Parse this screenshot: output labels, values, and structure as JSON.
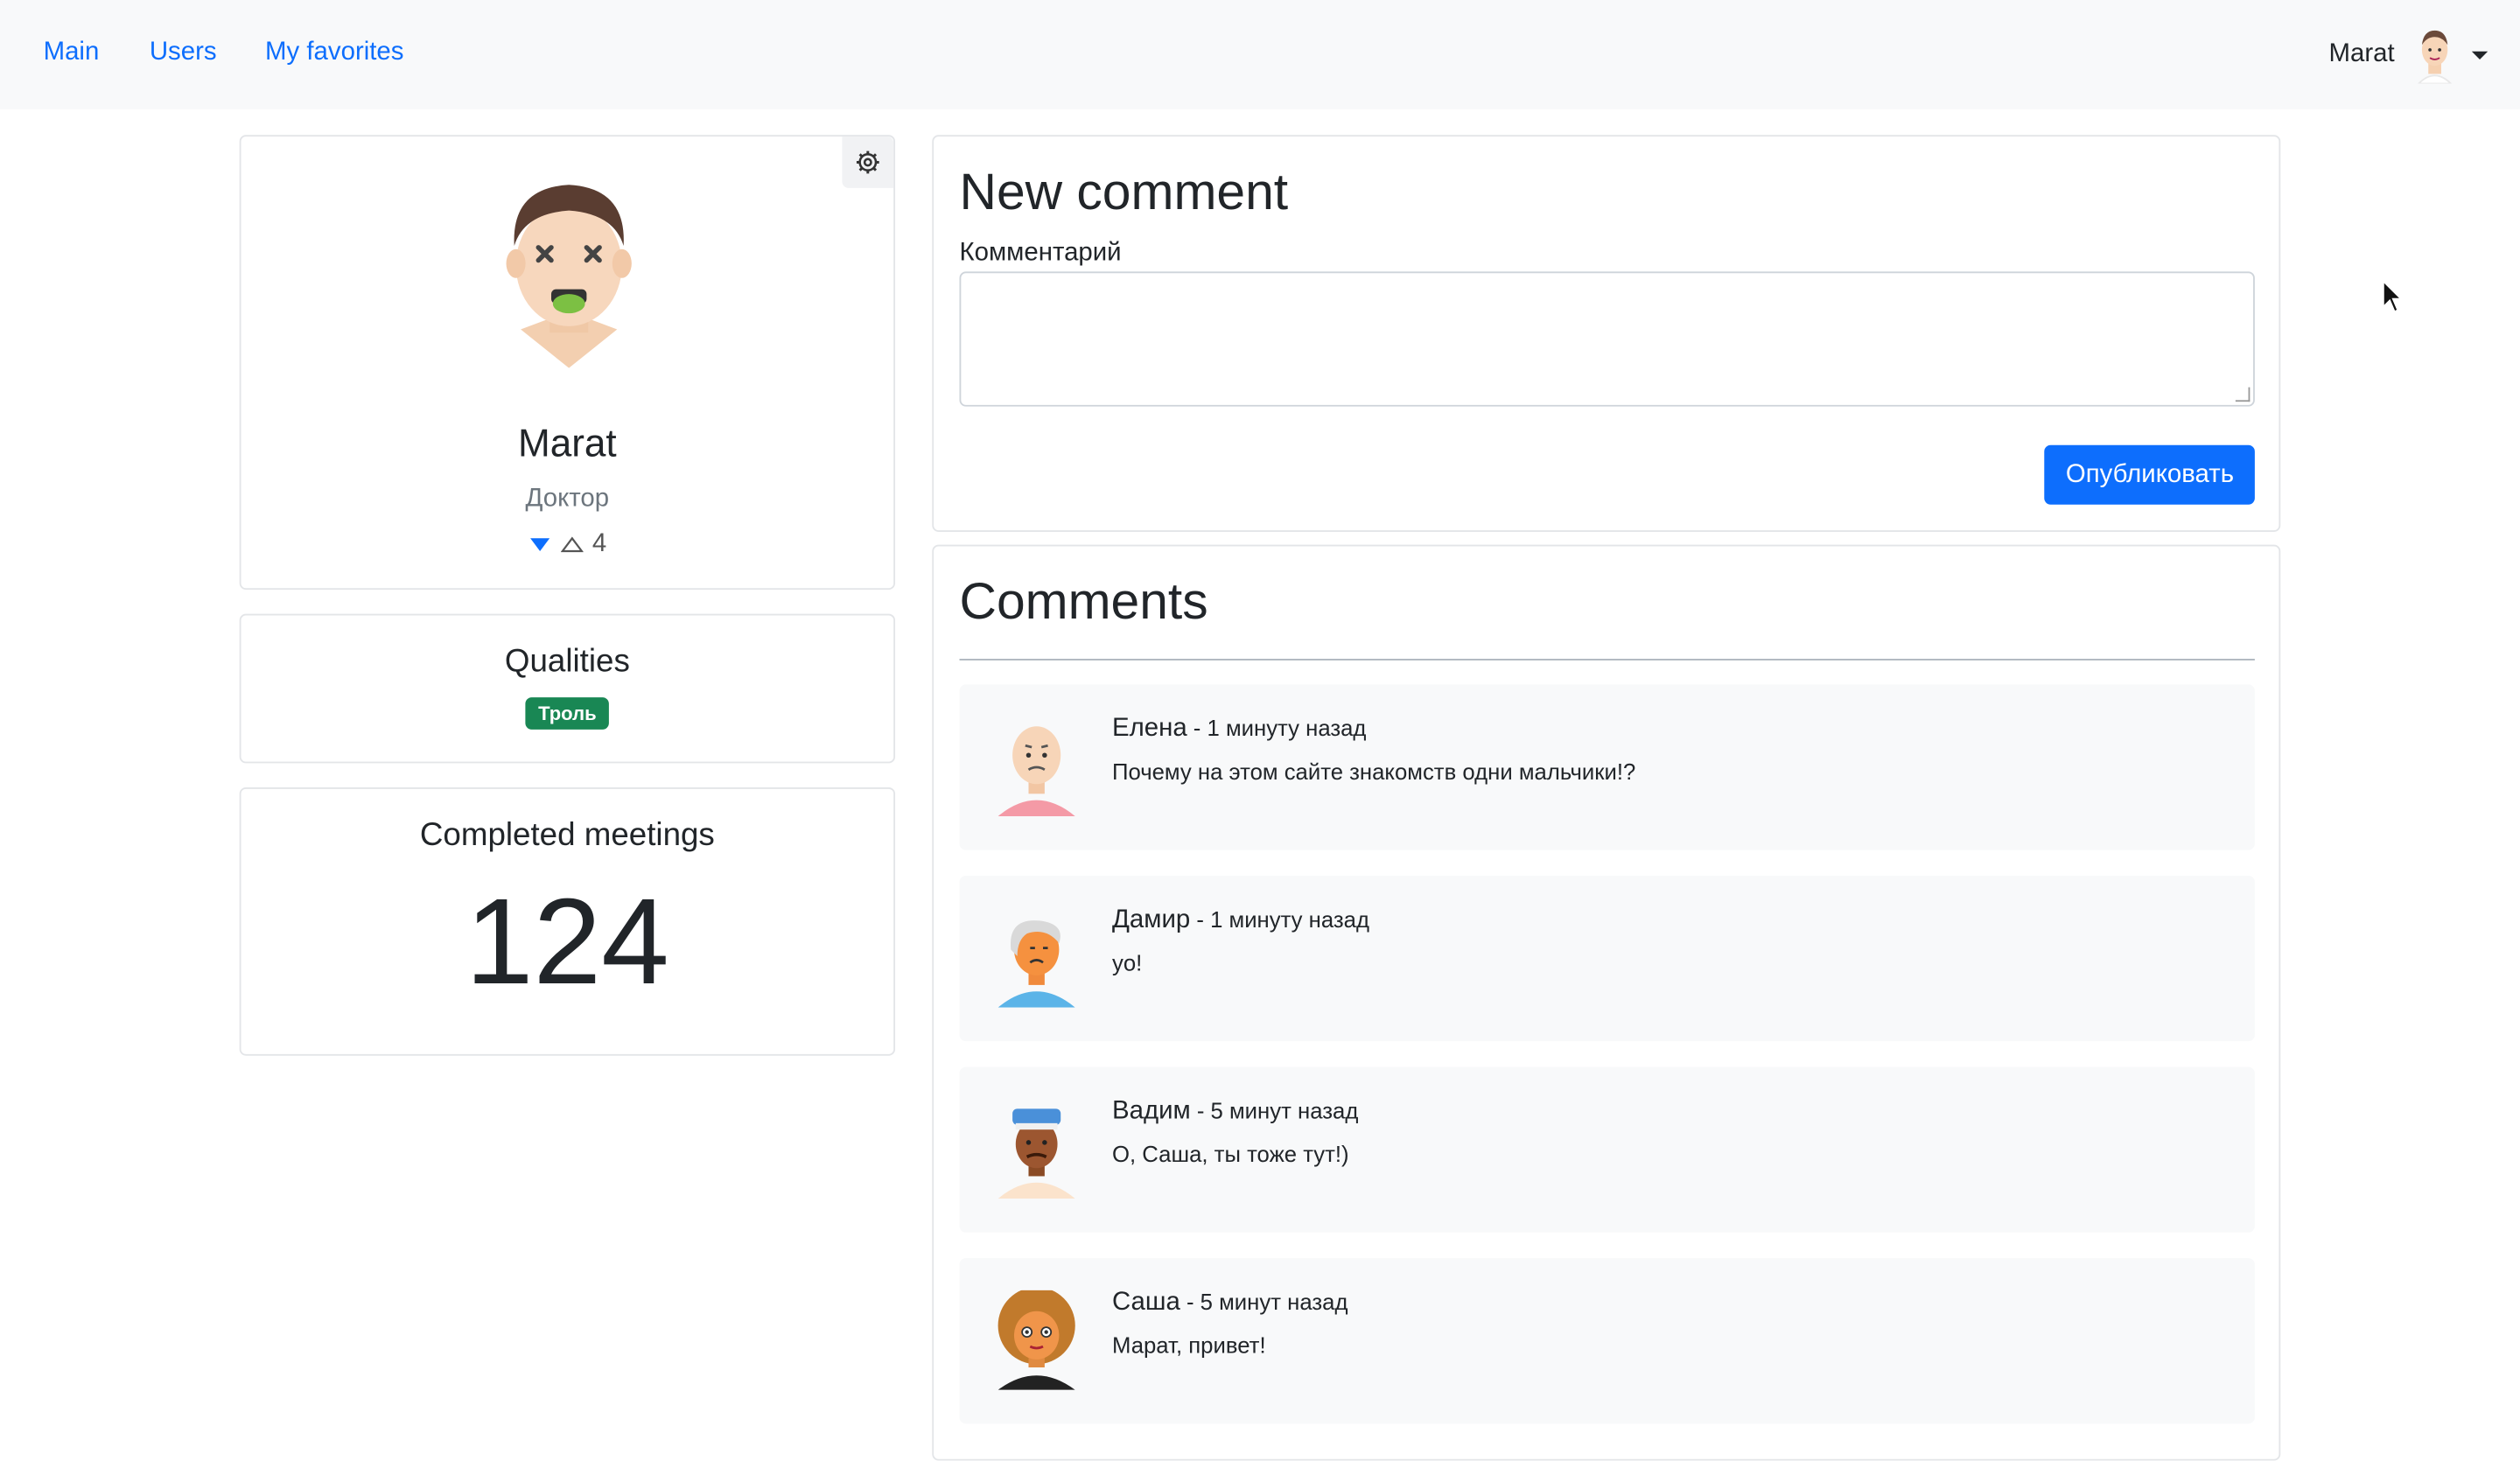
{
  "nav": {
    "links": [
      "Main",
      "Users",
      "My favorites"
    ],
    "user_name": "Marat"
  },
  "profile": {
    "name": "Marat",
    "role": "Доктор",
    "rating": "4",
    "settings_icon": "gear-icon"
  },
  "qualities": {
    "title": "Qualities",
    "badge": "Троль",
    "badge_color": "#198754"
  },
  "meetings": {
    "title": "Completed meetings",
    "count": "124"
  },
  "new_comment": {
    "title": "New comment",
    "field_label": "Комментарий",
    "field_value": "",
    "submit_label": "Опубликовать"
  },
  "comments": {
    "title": "Comments",
    "items": [
      {
        "author": "Елена",
        "time": " - 1 минуту назад",
        "text": "Почему на этом сайте знакомств одни мальчики!?"
      },
      {
        "author": "Дамир",
        "time": " - 1 минуту назад",
        "text": "yo!"
      },
      {
        "author": "Вадим",
        "time": " - 5 минут назад",
        "text": "О, Саша, ты тоже тут!)"
      },
      {
        "author": "Саша",
        "time": " - 5 минут назад",
        "text": "Марат, привет!"
      }
    ]
  },
  "colors": {
    "accent": "#0d6efd",
    "navbar_bg": "#f8f9fa"
  }
}
